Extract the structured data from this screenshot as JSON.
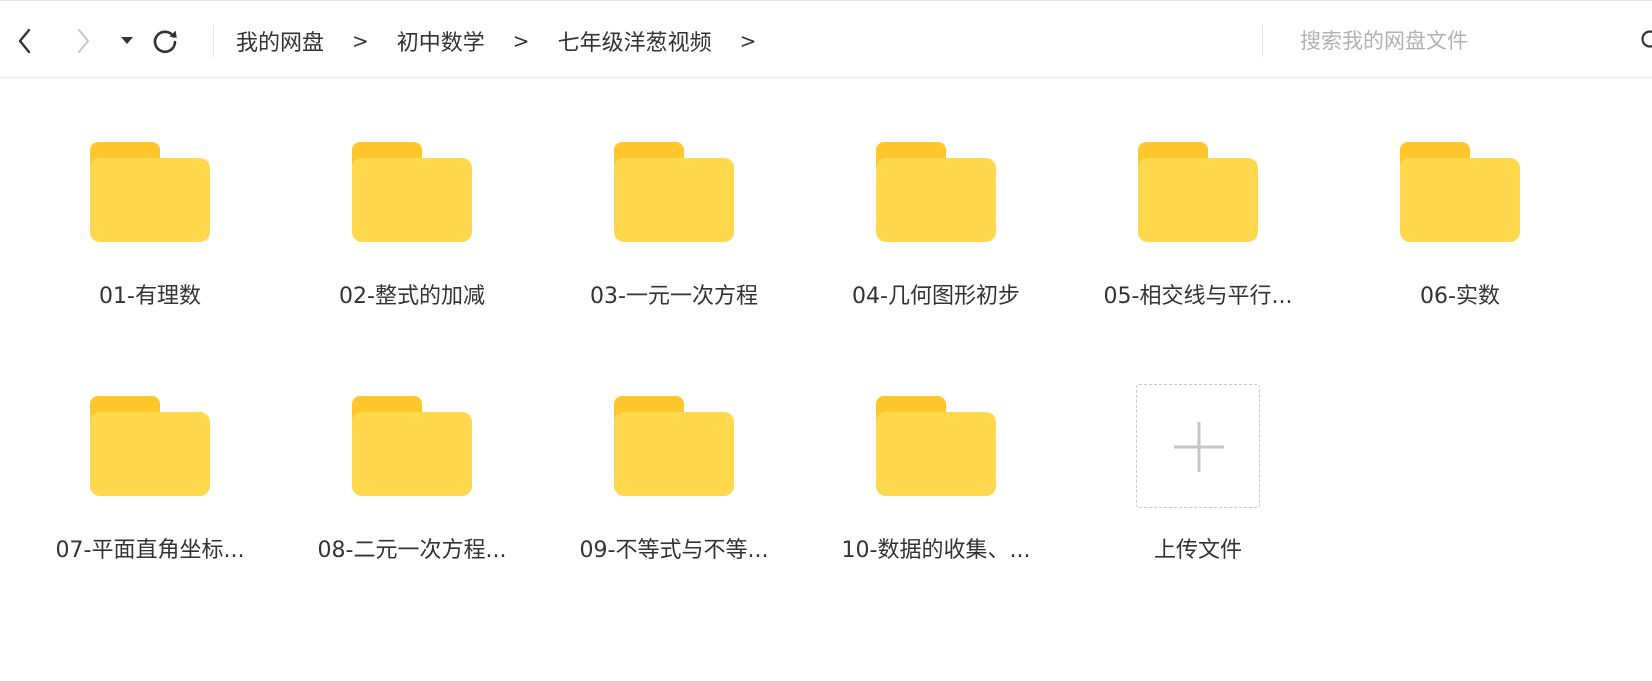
{
  "toolbar": {
    "back_icon": "chevron-left-icon",
    "forward_icon": "chevron-right-icon",
    "history_icon": "caret-down-icon",
    "refresh_icon": "refresh-icon"
  },
  "breadcrumb": {
    "items": [
      "我的网盘",
      "初中数学",
      "七年级洋葱视频"
    ],
    "separator": ">"
  },
  "search": {
    "placeholder": "搜索我的网盘文件",
    "value": "",
    "icon": "search-icon"
  },
  "colors": {
    "folder_body": "#ffd84d",
    "folder_tab": "#ffc72c",
    "text": "#333333",
    "placeholder": "#b2b2b2",
    "upload_border": "#c9c9c9",
    "plus": "#c6c6c6"
  },
  "folders": [
    {
      "name": "01-有理数"
    },
    {
      "name": "02-整式的加减"
    },
    {
      "name": "03-一元一次方程"
    },
    {
      "name": "04-几何图形初步"
    },
    {
      "name": "05-相交线与平行..."
    },
    {
      "name": "06-实数"
    },
    {
      "name": "07-平面直角坐标..."
    },
    {
      "name": "08-二元一次方程..."
    },
    {
      "name": "09-不等式与不等..."
    },
    {
      "name": "10-数据的收集、..."
    }
  ],
  "upload": {
    "label": "上传文件",
    "icon": "plus-icon"
  }
}
